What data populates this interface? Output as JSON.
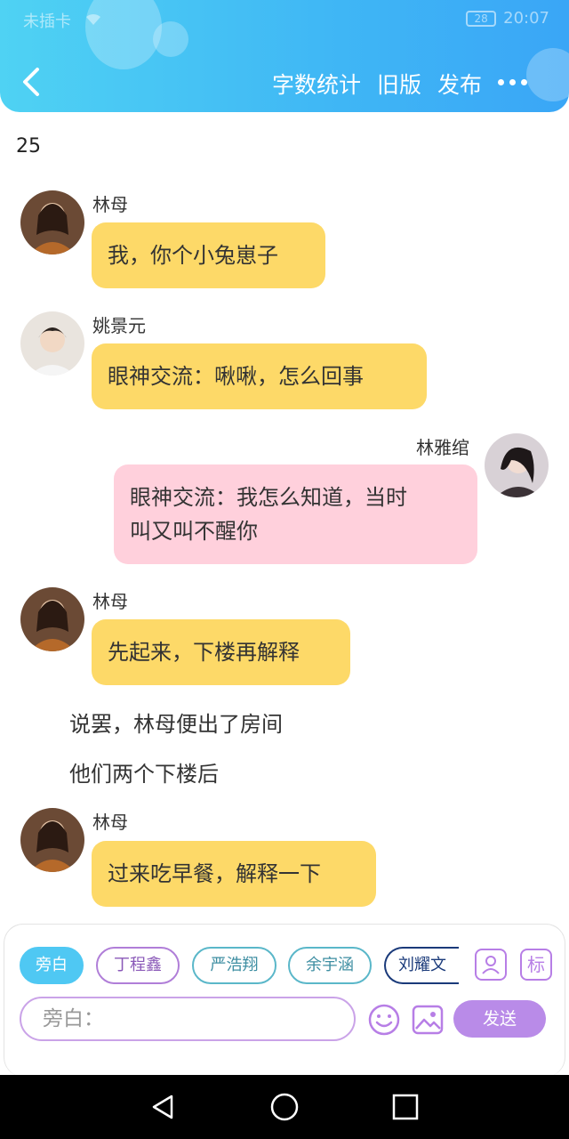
{
  "status_bar": {
    "carrier": "未插卡",
    "battery": "28",
    "time": "20:07"
  },
  "header": {
    "back_icon": "chevron-left-icon",
    "actions": [
      "字数统计",
      "旧版",
      "发布"
    ],
    "more_icon": "more-dots-icon"
  },
  "chapter": {
    "number": "25"
  },
  "messages": [
    {
      "speaker": "林母",
      "text": "我，你个小兔崽子"
    },
    {
      "speaker": "姚景元",
      "text": "眼神交流：啾啾，怎么回事"
    },
    {
      "speaker": "林雅绾",
      "text_line1": "眼神交流：我怎么知道，当时",
      "text_line2": "叫又叫不醒你"
    },
    {
      "speaker": "林母",
      "text": "先起来，下楼再解释"
    },
    {
      "speaker": "林母",
      "text": "过来吃早餐，解释一下"
    }
  ],
  "narrations": [
    "说罢，林母便出了房间",
    "他们两个下楼后"
  ],
  "composer": {
    "roles": [
      "旁白",
      "丁程鑫",
      "严浩翔",
      "余宇涵",
      "刘耀文"
    ],
    "role_tool_icon": "person-card-icon",
    "tag_tool_label": "标",
    "input_placeholder": "旁白：",
    "emoji_icon": "smiley-icon",
    "image_icon": "image-icon",
    "send_label": "发送"
  },
  "colors": {
    "header": "#3fb6f5",
    "left_bubble": "#fdd968",
    "right_bubble": "#ffd0dc",
    "send_button": "#b98be8"
  }
}
